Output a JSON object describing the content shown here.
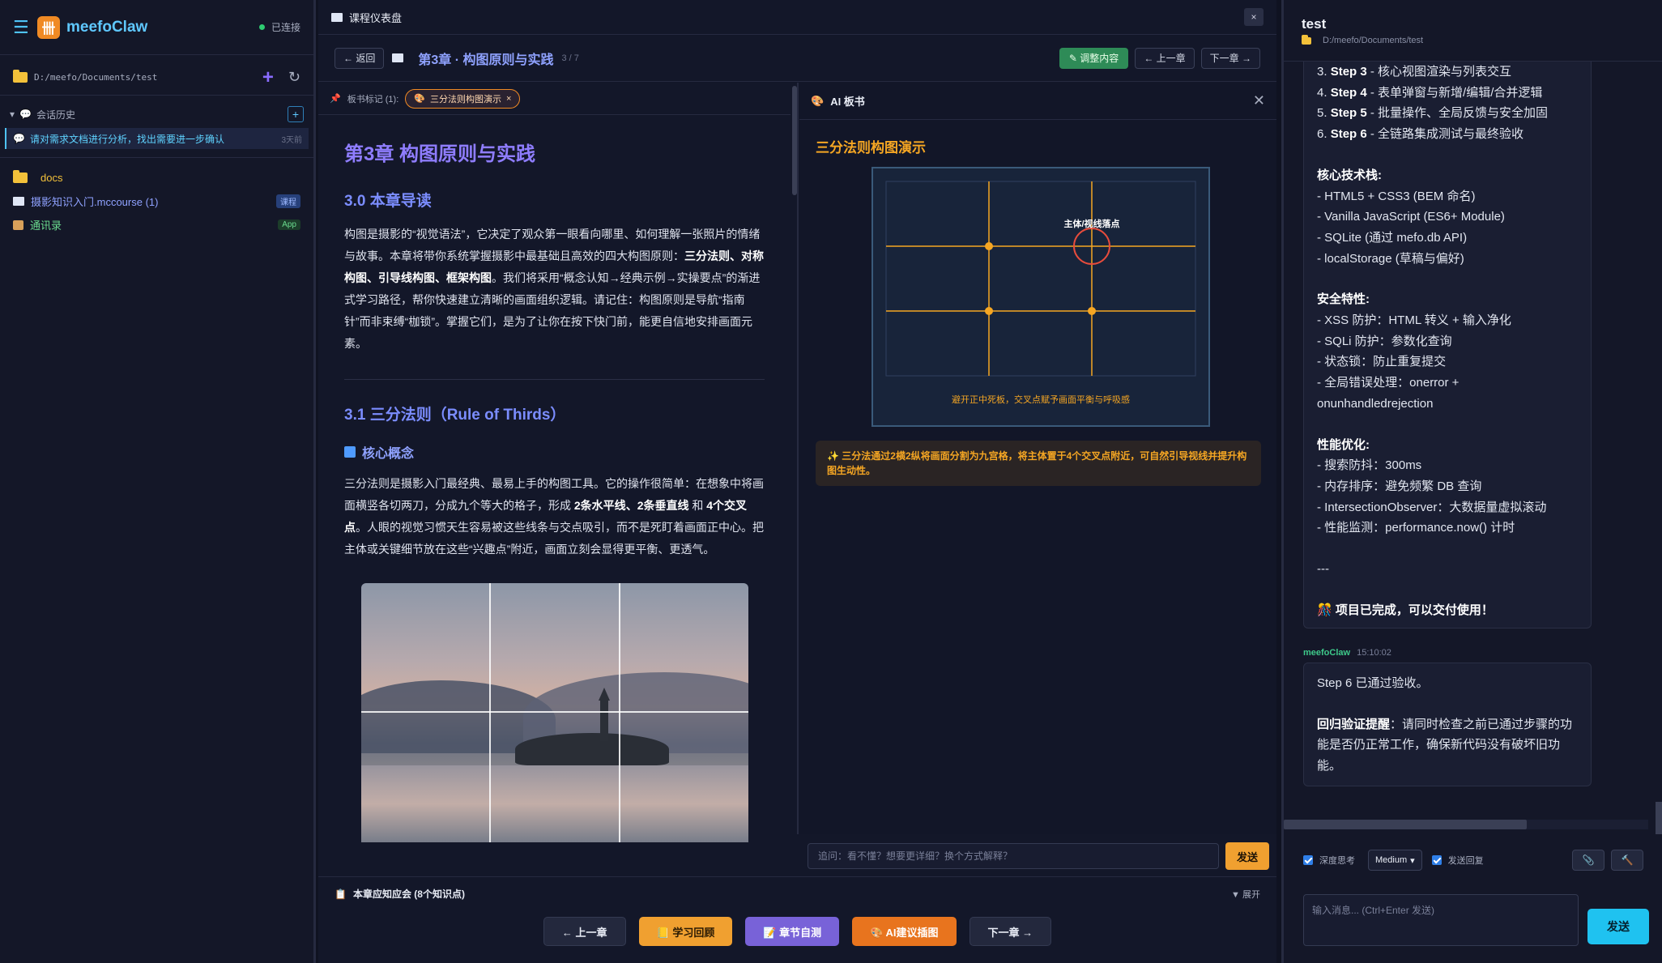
{
  "sidebar": {
    "app_name": "meefoClaw",
    "status": "已连接",
    "workspace_path": "D:/meefo/Documents/test",
    "history_label": "会话历史",
    "history_items": [
      {
        "title": "请对需求文档进行分析，找出需要进一步确认",
        "time": "3天前"
      }
    ],
    "files": [
      {
        "name": "docs",
        "tag": ""
      },
      {
        "name": "摄影知识入门.mccourse (1)",
        "tag": "课程"
      },
      {
        "name": "通讯录",
        "tag": "App"
      }
    ],
    "colors": {
      "accent": "#4fc3f7",
      "brand": "#f08a24"
    }
  },
  "center": {
    "window_title": "课程仪表盘",
    "close": "×",
    "back_label": "← 返回",
    "chapter_title": "第3章 · 构图原则与实践",
    "chapter_count": "3 / 7",
    "adjust_label": "调整内容",
    "prev_label": "← 上一章",
    "next_label": "下一章 →",
    "marks_label": "板书标记 (1):",
    "mark_chip": "三分法则构图演示",
    "mark_chip_close": "×",
    "reader": {
      "h1": "第3章 构图原则与实践",
      "s30_title": "3.0 本章导读",
      "s30_p1": "构图是摄影的“视觉语法”，它决定了观众第一眼看向哪里、如何理解一张照片的情绪与故事。本章将带你系统掌握摄影中最基础且高效的四大构图原则：",
      "s30_bold": "三分法则、对称构图、引导线构图、框架构图",
      "s30_p2": "。我们将采用“概念认知→经典示例→实操要点”的渐进式学习路径，帮你快速建立清晰的画面组织逻辑。请记住：构图原则是导航“指南针”而非束缚“枷锁”。掌握它们，是为了让你在按下快门前，能更自信地安排画面元素。",
      "s31_title": "3.1 三分法则（Rule of Thirds）",
      "core_title": "核心概念",
      "core_p1": "三分法则是摄影入门最经典、最易上手的构图工具。它的操作很简单：在想象中将画面横竖各切两刀，分成九个等大的格子，形成 ",
      "core_b1": "2条水平线",
      "core_sep": "、",
      "core_b2": "2条垂直线",
      "core_and": " 和 ",
      "core_b3": "4个交叉点",
      "core_p2": "。人眼的视觉习惯天生容易被这些线条与交点吸引，而不是死盯着画面正中心。把主体或关键细节放在这些“兴趣点”附近，画面立刻会显得更平衡、更透气。"
    },
    "board": {
      "header": "AI 板书",
      "title": "三分法则构图演示",
      "focus_label": "主体/视线落点",
      "caption": "避开正中死板，交叉点赋予画面平衡与呼吸感",
      "note": "✨ 三分法通过2横2纵将画面分割为九宫格，将主体置于4个交叉点附近，可自然引导视线并提升构图生动性。",
      "ask_placeholder": "追问：看不懂？想要更详细？换个方式解释？",
      "send_label": "发送"
    },
    "must_know": "本章应知应会 (8个知识点)",
    "expand_label": "▼ 展开",
    "bottom_nav": {
      "prev": "← 上一章",
      "review": "学习回顾",
      "quiz": "章节自测",
      "ai_illus": "AI建议插图",
      "next": "下一章 →"
    }
  },
  "chat": {
    "title": "test",
    "path": "D:/meefo/Documents/test",
    "msg1": {
      "steps": [
        {
          "n": "3. ",
          "b": "Step 3",
          "t": " - 核心视图渲染与列表交互"
        },
        {
          "n": "4. ",
          "b": "Step 4",
          "t": " - 表单弹窗与新增/编辑/合并逻辑"
        },
        {
          "n": "5. ",
          "b": "Step 5",
          "t": " - 批量操作、全局反馈与安全加固"
        },
        {
          "n": "6. ",
          "b": "Step 6",
          "t": " - 全链路集成测试与最终验收"
        }
      ],
      "tech_title": "核心技术栈:",
      "tech": [
        "- HTML5 + CSS3 (BEM 命名)",
        "- Vanilla JavaScript (ES6+ Module)",
        "- SQLite (通过 mefo.db API)",
        "- localStorage (草稿与偏好)"
      ],
      "sec_title": "安全特性:",
      "sec": [
        "- XSS 防护：HTML 转义 + 输入净化",
        "- SQLi 防护：参数化查询",
        "- 状态锁：防止重复提交",
        "- 全局错误处理：onerror +",
        "onunhandledrejection"
      ],
      "perf_title": "性能优化:",
      "perf": [
        "- 搜索防抖：300ms",
        "- 内存排序：避免频繁 DB 查询",
        "- IntersectionObserver：大数据量虚拟滚动",
        "- 性能监测：performance.now() 计时"
      ],
      "sep": "---",
      "done": "🎊 项目已完成，可以交付使用！"
    },
    "msg2_sender": "meefoClaw",
    "msg2_time": "15:10:02",
    "msg2_p1": "Step 6 已通过验收。",
    "msg2_b": "回归验证提醒",
    "msg2_p2": "：请同时检查之前已通过步骤的功能是否仍正常工作，确保新代码没有破坏旧功能。",
    "deep_think": "深度思考",
    "level": "Medium",
    "send_reply": "发送回复",
    "input_placeholder": "输入消息... (Ctrl+Enter 发送)",
    "send_label": "发送"
  }
}
